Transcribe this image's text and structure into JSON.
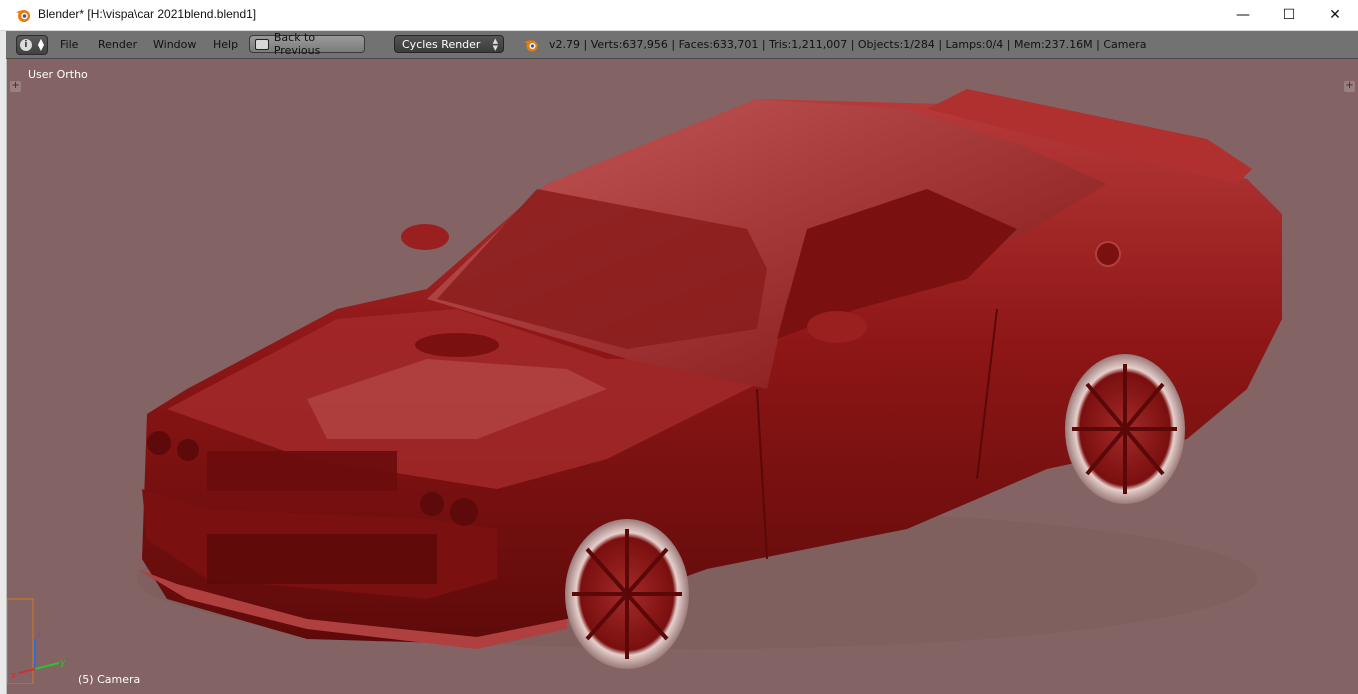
{
  "window": {
    "title": "Blender* [H:\\vispa\\car 2021blend.blend1]",
    "controls": {
      "minimize": "—",
      "maximize": "☐",
      "close": "✕"
    }
  },
  "header": {
    "editor_icon": "info-icon",
    "menu": [
      "File",
      "Render",
      "Window",
      "Help"
    ],
    "back_button": "Back to Previous",
    "render_engine": "Cycles Render",
    "stats": "v2.79 | Verts:637,956 | Faces:633,701 | Tris:1,211,007 | Objects:1/284 | Lamps:0/4 | Mem:237.16M | Camera"
  },
  "viewport": {
    "view_name": "User Ortho",
    "active_object": "(5) Camera",
    "background_color": "#836363",
    "model_color": "#8a1212",
    "axis_labels": {
      "x": "x",
      "y": "y",
      "z": "z"
    }
  },
  "colors": {
    "header_bg": "#727272",
    "accent_orange": "#e87d0d"
  }
}
